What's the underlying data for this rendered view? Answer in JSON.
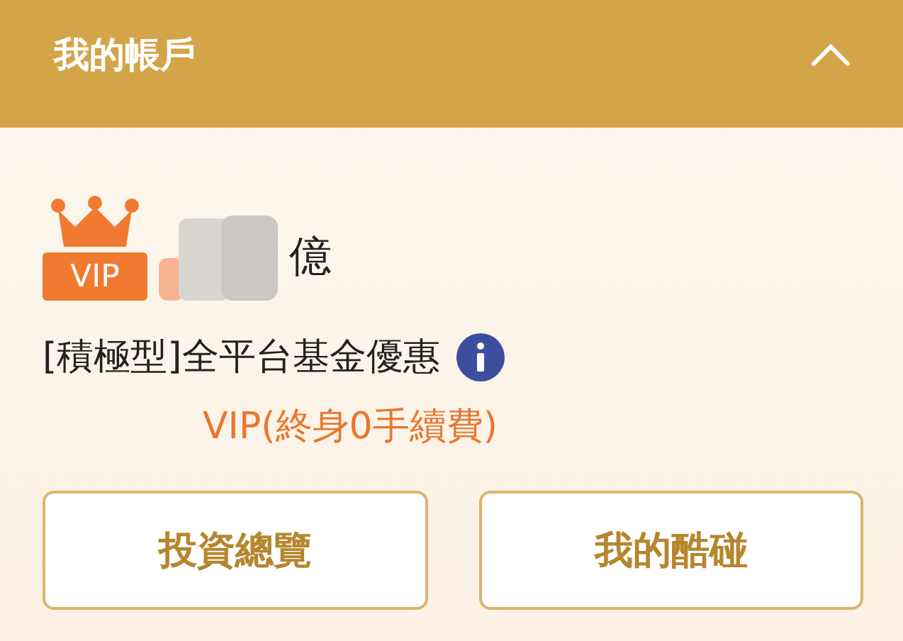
{
  "header": {
    "title": "我的帳戶",
    "expanded": true
  },
  "membership": {
    "badge": "VIP",
    "amount_suffix": "億"
  },
  "offer": {
    "title": "[積極型]全平台基金優惠",
    "note": "VIP(終身0手續費)"
  },
  "buttons": [
    {
      "label": "投資總覽"
    },
    {
      "label": "我的酷碰"
    }
  ]
}
